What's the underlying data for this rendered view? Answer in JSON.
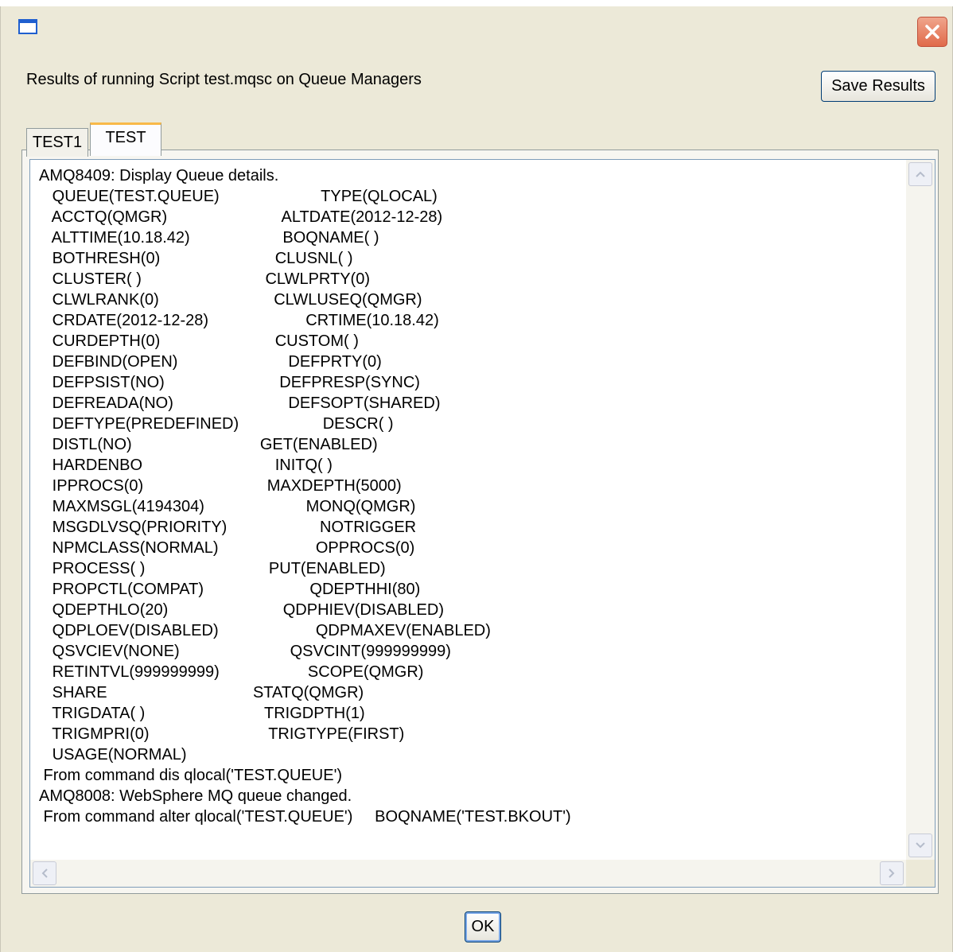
{
  "header": {
    "title": "Results of running Script test.mqsc on Queue Managers",
    "save_label": "Save Results"
  },
  "tabs": [
    {
      "label": "TEST1",
      "selected": false
    },
    {
      "label": "TEST",
      "selected": true
    }
  ],
  "output_text": "AMQ8409: Display Queue details.\n   QUEUE(TEST.QUEUE)                       TYPE(QLOCAL)\n   ACCTQ(QMGR)                          ALTDATE(2012-12-28)\n   ALTTIME(10.18.42)                     BOQNAME( )\n   BOTHRESH(0)                          CLUSNL( )\n   CLUSTER( )                            CLWLPRTY(0)\n   CLWLRANK(0)                          CLWLUSEQ(QMGR)\n   CRDATE(2012-12-28)                      CRTIME(10.18.42)\n   CURDEPTH(0)                          CUSTOM( )\n   DEFBIND(OPEN)                         DEFPRTY(0)\n   DEFPSIST(NO)                          DEFPRESP(SYNC)\n   DEFREADA(NO)                          DEFSOPT(SHARED)\n   DEFTYPE(PREDEFINED)                   DESCR( )\n   DISTL(NO)                             GET(ENABLED)\n   HARDENBO                              INITQ( )\n   IPPROCS(0)                            MAXDEPTH(5000)\n   MAXMSGL(4194304)                       MONQ(QMGR)\n   MSGDLVSQ(PRIORITY)                     NOTRIGGER\n   NPMCLASS(NORMAL)                      OPPROCS(0)\n   PROCESS( )                            PUT(ENABLED)\n   PROPCTL(COMPAT)                        QDEPTHHI(80)\n   QDEPTHLO(20)                          QDPHIEV(DISABLED)\n   QDPLOEV(DISABLED)                      QDPMAXEV(ENABLED)\n   QSVCIEV(NONE)                         QSVCINT(999999999)\n   RETINTVL(999999999)                    SCOPE(QMGR)\n   SHARE                                 STATQ(QMGR)\n   TRIGDATA( )                           TRIGDPTH(1)\n   TRIGMPRI(0)                           TRIGTYPE(FIRST)\n   USAGE(NORMAL)\n From command dis qlocal('TEST.QUEUE')\nAMQ8008: WebSphere MQ queue changed.\n From command alter qlocal('TEST.QUEUE')     BOQNAME('TEST.BKOUT')",
  "ok_label": "OK",
  "icons": {
    "app": "window-icon",
    "close": "close-icon"
  }
}
